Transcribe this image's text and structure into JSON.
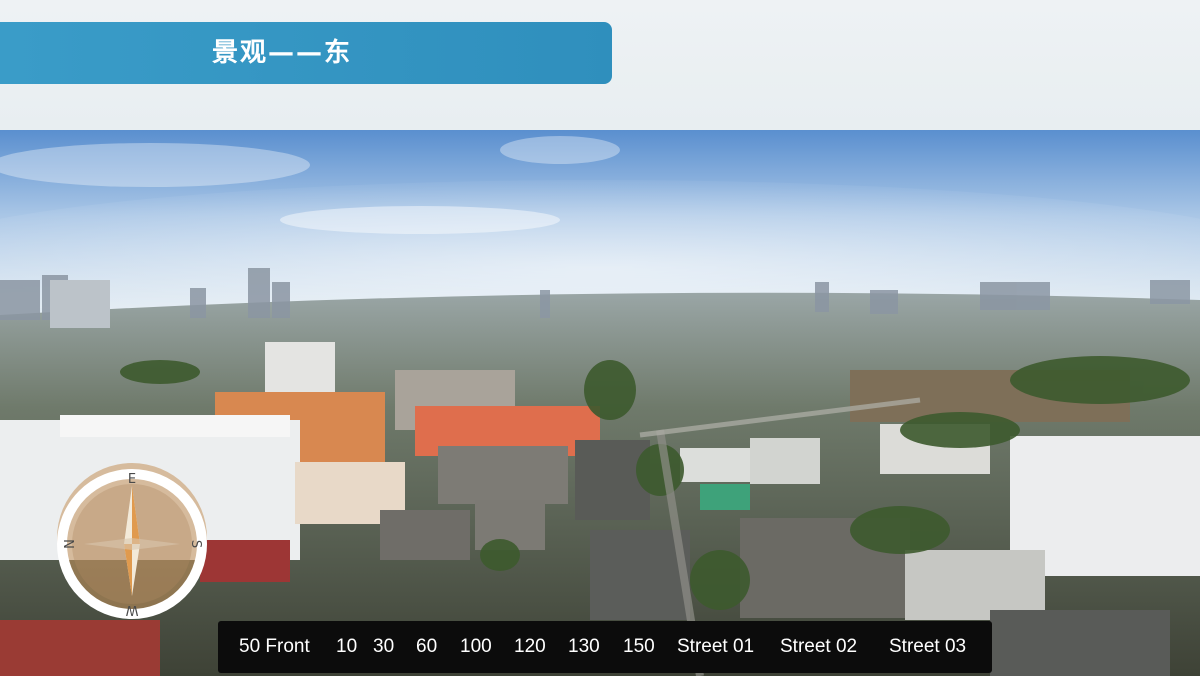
{
  "header": {
    "title": "景观——东",
    "accent_color": "#3195c2"
  },
  "photo": {
    "icon": "panorama-image"
  },
  "compass": {
    "icon": "compass-icon",
    "north": "N",
    "east": "E",
    "south": "S",
    "west": "W"
  },
  "floor_bar": {
    "items": [
      "50 Front",
      "10",
      "30",
      "60",
      "100",
      "120",
      "130",
      "150",
      "Street 01",
      "Street 02",
      "Street 03"
    ]
  }
}
